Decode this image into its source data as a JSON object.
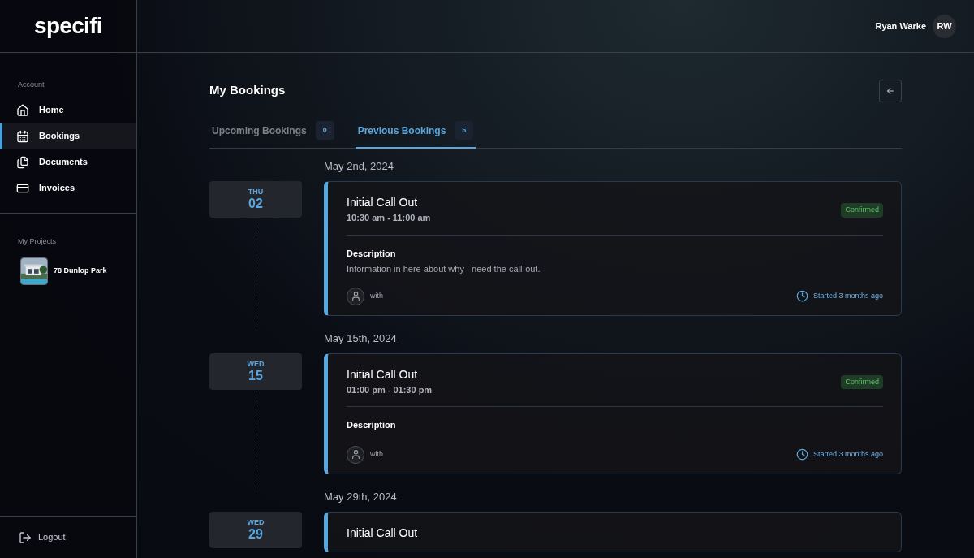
{
  "logo": "specifi",
  "user": {
    "name": "Ryan Warke",
    "initials": "RW"
  },
  "sidebar": {
    "sections": [
      {
        "title": "Account",
        "items": [
          {
            "label": "Home",
            "selected": false
          },
          {
            "label": "Bookings",
            "selected": true
          },
          {
            "label": "Documents",
            "selected": false
          },
          {
            "label": "Invoices",
            "selected": false
          }
        ]
      }
    ],
    "projects_title": "My Projects",
    "projects": [
      {
        "name": "78 Dunlop Park",
        "kind": "picture"
      }
    ],
    "logout": "Logout"
  },
  "page_title": "My Bookings",
  "tabs": [
    {
      "label": "Upcoming Bookings",
      "count": "0",
      "selected": false
    },
    {
      "label": "Previous Bookings",
      "count": "5",
      "selected": true
    }
  ],
  "bookings": [
    {
      "date": "May 2nd, 2024",
      "weekday": "THU",
      "day": "02",
      "title": "Initial Call Out",
      "time": "10:30 am - 11:00 am",
      "status": "Confirmed",
      "description_label": "Description",
      "description": "Information in here about why I need the call-out.",
      "with": "with",
      "started": "Started 3 months ago"
    },
    {
      "date": "May 15th, 2024",
      "weekday": "WED",
      "day": "15",
      "title": "Initial Call Out",
      "time": "01:00 pm - 01:30 pm",
      "status": "Confirmed",
      "description_label": "Description",
      "with": "with",
      "started": "Started 3 months ago"
    },
    {
      "date": "May 29th, 2024",
      "weekday": "WED",
      "day": "29",
      "title": "Initial Call Out"
    }
  ]
}
